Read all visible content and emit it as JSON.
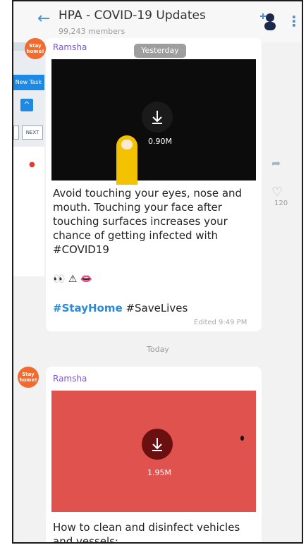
{
  "background_app": {
    "new_task_label": "New Task",
    "next_label": "NEXT"
  },
  "header": {
    "title": "HPA - COVID-19 Updates",
    "members": "99,243 members"
  },
  "badges": {
    "stay_home": "Stay home!"
  },
  "date_pills": {
    "yesterday": "Yesterday",
    "today": "Today"
  },
  "messages": [
    {
      "sender": "Ramsha",
      "media_size": "0.90M",
      "text": "Avoid touching your eyes, nose and mouth. Touching your face after touching surfaces increases your chance of getting infected with #COVID19",
      "emojis": "👀 ⚠ 👄",
      "hashtag_highlight": "#StayHome",
      "hashtag_plain": "#SaveLives",
      "edited": "Edited 9:49 PM",
      "likes": "120"
    },
    {
      "sender": "Ramsha",
      "media_size": "1.95M",
      "text": "How to clean and disinfect vehicles and vessels;"
    }
  ],
  "icons": {
    "back": "arrow-left-icon",
    "add_member": "add-member-icon",
    "menu": "kebab-menu-icon",
    "download": "download-icon",
    "share": "share-icon",
    "like": "heart-icon"
  },
  "colors": {
    "accent": "#4a8fd0",
    "sender": "#7b58c7",
    "hashtag": "#2a8ad7",
    "badge": "#f26a2e",
    "media1_bg": "#0c0c0c",
    "media2_bg": "#e0524e"
  }
}
